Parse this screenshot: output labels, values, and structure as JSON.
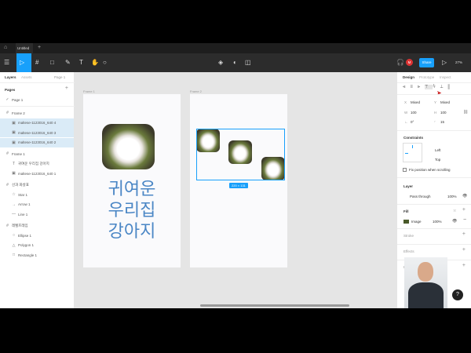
{
  "tabs": {
    "file_tab": "Untitled",
    "add": "+"
  },
  "toolbar": {
    "share": "Share",
    "zoom": "27%",
    "avatar": "M"
  },
  "left": {
    "tab_layers": "Layers",
    "tab_assets": "Assets",
    "page_select": "Page 1",
    "pages_title": "Pages",
    "page1": "Page 1",
    "layers": [
      {
        "label": "Frame 2",
        "icon": "#",
        "indent": 0,
        "sel": false
      },
      {
        "label": "maltese-1123016_640 4",
        "icon": "▣",
        "indent": 1,
        "sel": true
      },
      {
        "label": "maltese-1123016_640 3",
        "icon": "▣",
        "indent": 1,
        "sel": true
      },
      {
        "label": "maltese-1123016_640 2",
        "icon": "▣",
        "indent": 1,
        "sel": true
      },
      {
        "label": "Frame 1",
        "icon": "#",
        "indent": 0,
        "sel": false
      },
      {
        "label": "귀여운 우리집 강아지",
        "icon": "T",
        "indent": 1,
        "sel": false
      },
      {
        "label": "maltese-1123016_640 1",
        "icon": "▣",
        "indent": 1,
        "sel": false
      },
      {
        "label": "선과 화살표",
        "icon": "#",
        "indent": 0,
        "sel": false
      },
      {
        "label": "Star 1",
        "icon": "☆",
        "indent": 1,
        "sel": false
      },
      {
        "label": "Arrow 1",
        "icon": "→",
        "indent": 1,
        "sel": false
      },
      {
        "label": "Line 1",
        "icon": "—",
        "indent": 1,
        "sel": false
      },
      {
        "label": "레벨프레임",
        "icon": "#",
        "indent": 0,
        "sel": false
      },
      {
        "label": "Ellipse 1",
        "icon": "○",
        "indent": 1,
        "sel": false
      },
      {
        "label": "Polygon 1",
        "icon": "△",
        "indent": 1,
        "sel": false
      },
      {
        "label": "Rectangle 1",
        "icon": "□",
        "indent": 1,
        "sel": false
      }
    ]
  },
  "canvas": {
    "frame1_label": "Frame 1",
    "frame2_label": "Frame 2",
    "headline": [
      "귀여운",
      "우리집",
      "강아지"
    ],
    "selection_size": "220 × 131"
  },
  "right": {
    "tab_design": "Design",
    "tab_prototype": "Prototype",
    "tab_inspect": "Inspect",
    "x_label": "X",
    "x_value": "Mixed",
    "y_label": "Y",
    "y_value": "Mixed",
    "w_label": "W",
    "w_value": "100",
    "h_label": "H",
    "h_value": "100",
    "rotation": "0°",
    "radius": "15",
    "constraints_title": "Constraints",
    "constraint_h": "Left",
    "constraint_v": "Top",
    "fix_position": "Fix position when scrolling",
    "layer_title": "Layer",
    "blend": "Pass through",
    "layer_opacity": "100%",
    "fill_title": "Fill",
    "fill_type": "Image",
    "fill_opacity": "100%",
    "stroke_title": "Stroke",
    "effects_title": "Effects",
    "export_title": "Export"
  },
  "help": "?",
  "colors": {
    "accent": "#18a0fb",
    "text_blue": "#4a86c5",
    "selection": "#daebf7"
  }
}
